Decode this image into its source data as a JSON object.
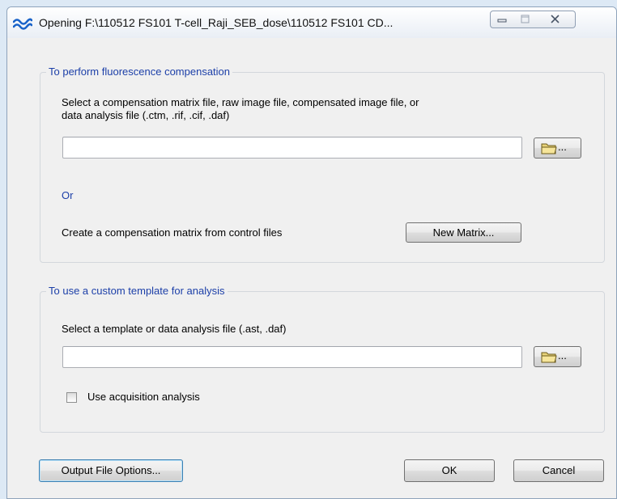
{
  "window": {
    "title": "Opening F:\\110512 FS101 T-cell_Raji_SEB_dose\\110512 FS101 CD...",
    "icon": "app-wave-icon",
    "controls": {
      "minimize": "minimize-icon",
      "maximize": "maximize-icon",
      "close": "close-icon"
    }
  },
  "compensation_group": {
    "legend": "To perform fluorescence compensation",
    "instruction_line1": "Select a compensation matrix file, raw image file, compensated image file, or",
    "instruction_line2": "data analysis file (.ctm, .rif, .cif, .daf)",
    "file_value": "",
    "browse_label": "...",
    "or_label": "Or",
    "create_label": "Create a compensation matrix from control files",
    "new_matrix_button": "New Matrix..."
  },
  "template_group": {
    "legend": "To use a custom template for analysis",
    "instruction": "Select a template or data analysis file (.ast, .daf)",
    "file_value": "",
    "browse_label": "...",
    "checkbox_label": "Use acquisition analysis",
    "checkbox_checked": false
  },
  "footer": {
    "output_options_button": "Output File Options...",
    "ok_button": "OK",
    "cancel_button": "Cancel"
  }
}
